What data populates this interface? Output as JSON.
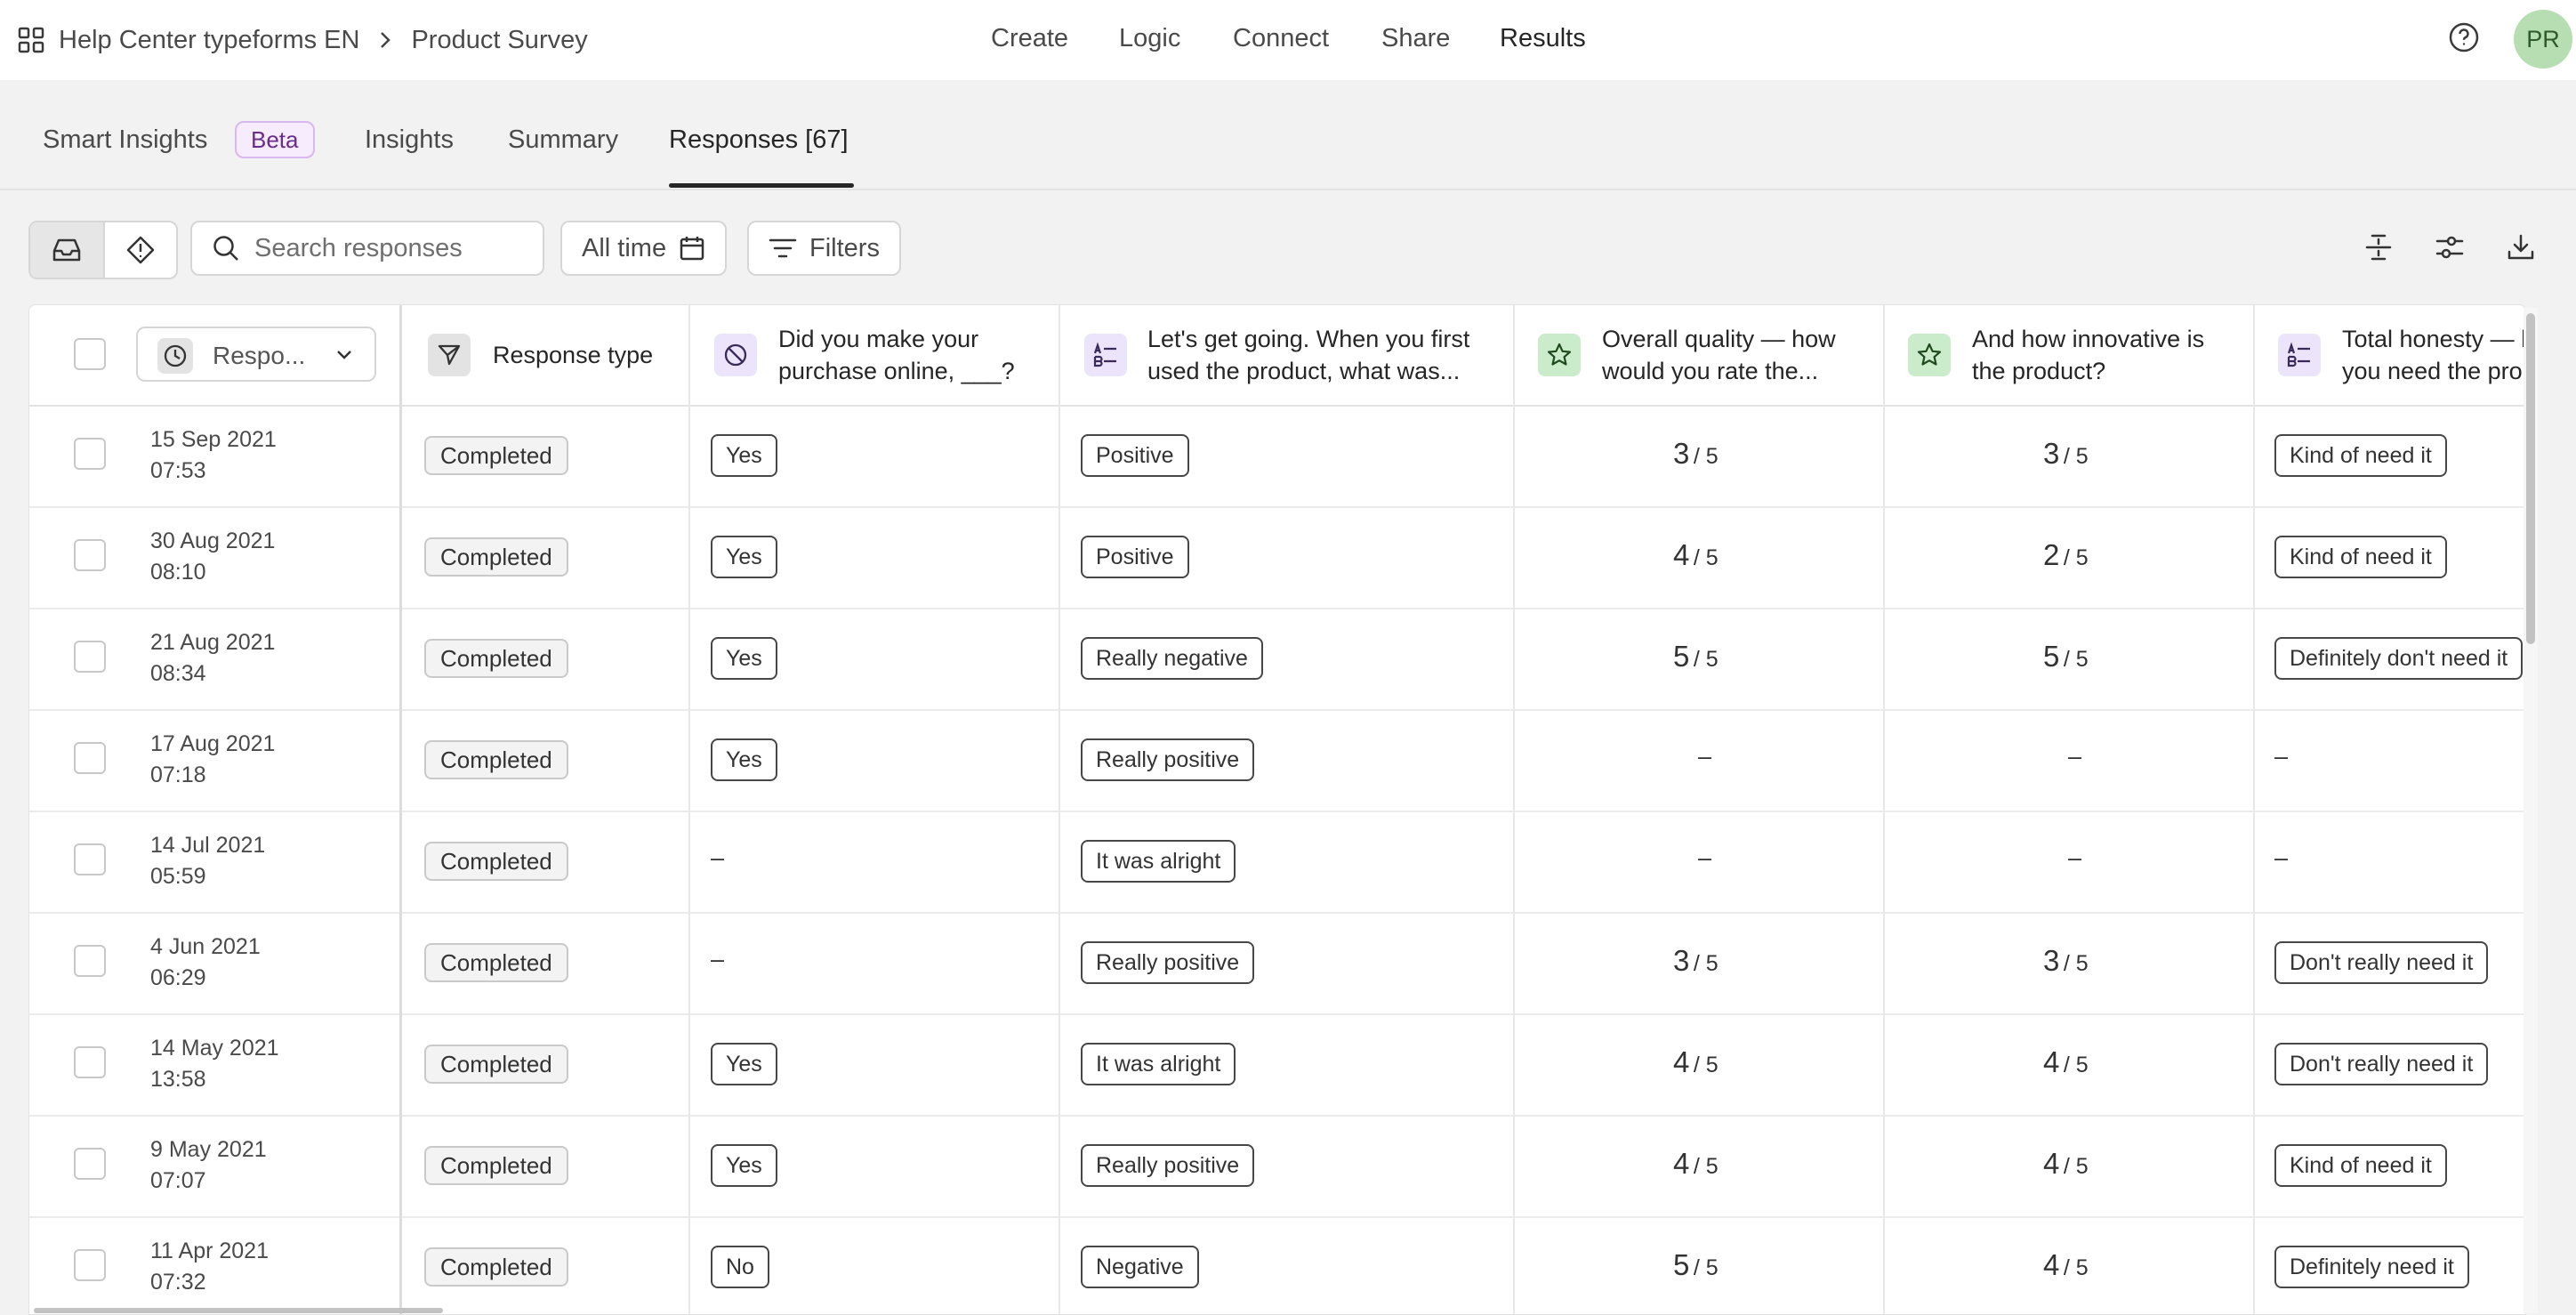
{
  "breadcrumb": {
    "workspace": "Help Center typeforms EN",
    "separator": ">",
    "form": "Product Survey"
  },
  "nav": {
    "create": "Create",
    "logic": "Logic",
    "connect": "Connect",
    "share": "Share",
    "results": "Results"
  },
  "user": {
    "initials": "PR"
  },
  "tabs": {
    "smart_insights": "Smart Insights",
    "beta": "Beta",
    "insights": "Insights",
    "summary": "Summary",
    "responses": "Responses [67]"
  },
  "toolbar": {
    "search_placeholder": "Search responses",
    "time_filter": "All time",
    "filters": "Filters"
  },
  "columns": {
    "sort": "Respo...",
    "response_type": "Response type",
    "q1": [
      "Did you make your",
      "purchase online, ___?"
    ],
    "q2": [
      "Let's get going. When you first",
      "used the product, what was..."
    ],
    "q3": [
      "Overall quality — how",
      "would you rate the..."
    ],
    "q4": [
      "And how innovative is",
      "the product?"
    ],
    "q5": [
      "Total honesty — h",
      "you need the pro"
    ]
  },
  "rows": [
    {
      "date": "15 Sep 2021",
      "time": "07:53",
      "type": "Completed",
      "online": "Yes",
      "first": "Positive",
      "quality": "3",
      "innovative": "3",
      "need": "Kind of need it"
    },
    {
      "date": "30 Aug 2021",
      "time": "08:10",
      "type": "Completed",
      "online": "Yes",
      "first": "Positive",
      "quality": "4",
      "innovative": "2",
      "need": "Kind of need it"
    },
    {
      "date": "21 Aug 2021",
      "time": "08:34",
      "type": "Completed",
      "online": "Yes",
      "first": "Really negative",
      "quality": "5",
      "innovative": "5",
      "need": "Definitely don't need it"
    },
    {
      "date": "17 Aug 2021",
      "time": "07:18",
      "type": "Completed",
      "online": "Yes",
      "first": "Really positive",
      "quality": "–",
      "innovative": "–",
      "need": "–"
    },
    {
      "date": "14 Jul 2021",
      "time": "05:59",
      "type": "Completed",
      "online": "–",
      "first": "It was alright",
      "quality": "–",
      "innovative": "–",
      "need": "–"
    },
    {
      "date": "4 Jun 2021",
      "time": "06:29",
      "type": "Completed",
      "online": "–",
      "first": "Really positive",
      "quality": "3",
      "innovative": "3",
      "need": "Don't really need it"
    },
    {
      "date": "14 May 2021",
      "time": "13:58",
      "type": "Completed",
      "online": "Yes",
      "first": "It was alright",
      "quality": "4",
      "innovative": "4",
      "need": "Don't really need it"
    },
    {
      "date": "9 May 2021",
      "time": "07:07",
      "type": "Completed",
      "online": "Yes",
      "first": "Really positive",
      "quality": "4",
      "innovative": "4",
      "need": "Kind of need it"
    },
    {
      "date": "11 Apr 2021",
      "time": "07:32",
      "type": "Completed",
      "online": "No",
      "first": "Negative",
      "quality": "5",
      "innovative": "4",
      "need": "Definitely need it"
    }
  ],
  "rating_suffix": "/ 5",
  "colors": {
    "accent_purple": "#ece4fb",
    "accent_green": "#cbeccb",
    "beta_border": "#d8b8ee",
    "avatar": "#b7ddb2"
  },
  "icons": [
    "grid-icon",
    "chevron-right-icon",
    "help-icon",
    "inbox-icon",
    "alert-diamond-icon",
    "search-icon",
    "calendar-icon",
    "filter-icon",
    "row-height-icon",
    "settings-sliders-icon",
    "download-icon",
    "clock-icon",
    "chevron-down-icon",
    "send-icon",
    "yes-no-icon",
    "text-choice-icon",
    "star-icon"
  ]
}
